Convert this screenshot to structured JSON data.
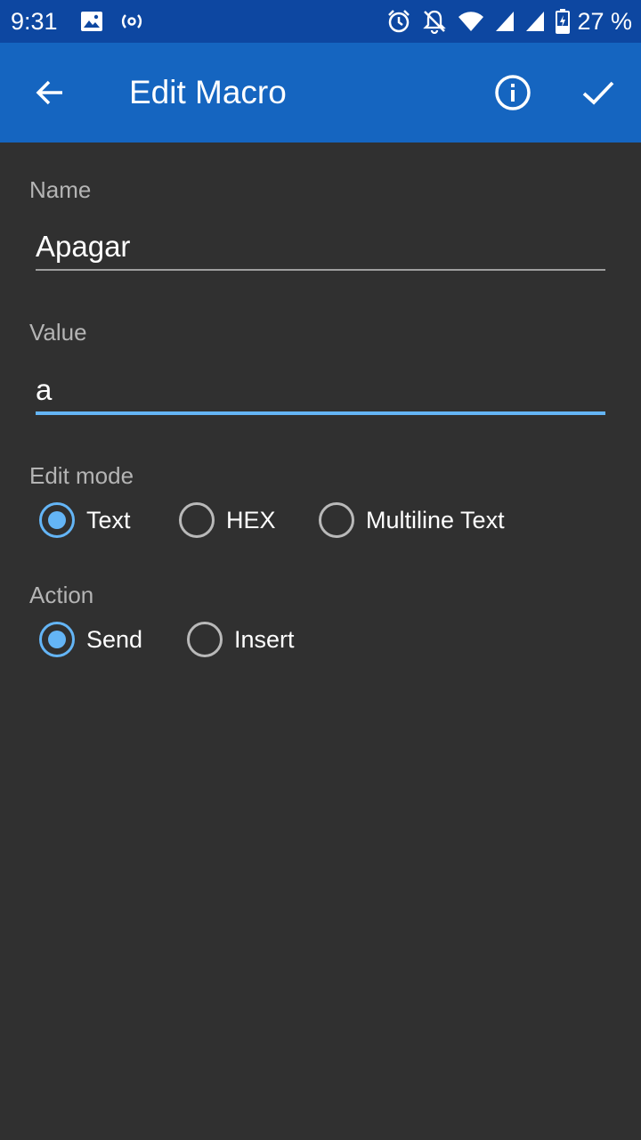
{
  "status_bar": {
    "time": "9:31",
    "battery_percent": "27 %",
    "icons": [
      "image-icon",
      "radio-broadcast-icon",
      "alarm-icon",
      "notifications-off-icon",
      "wifi-icon",
      "signal-icon",
      "signal-icon",
      "battery-charging-icon"
    ]
  },
  "app_bar": {
    "title": "Edit Macro",
    "icons": [
      "back-arrow-icon",
      "info-icon",
      "check-icon"
    ]
  },
  "form": {
    "name_label": "Name",
    "name_value": "Apagar",
    "value_label": "Value",
    "value_value": "a",
    "edit_mode_label": "Edit mode",
    "edit_mode_options": [
      {
        "label": "Text",
        "checked": true
      },
      {
        "label": "HEX",
        "checked": false
      },
      {
        "label": "Multiline Text",
        "checked": false
      }
    ],
    "action_label": "Action",
    "action_options": [
      {
        "label": "Send",
        "checked": true
      },
      {
        "label": "Insert",
        "checked": false
      }
    ]
  },
  "colors": {
    "status_bar": "#0d47a1",
    "app_bar": "#1565c0",
    "background": "#303030",
    "accent": "#64b5f6"
  }
}
